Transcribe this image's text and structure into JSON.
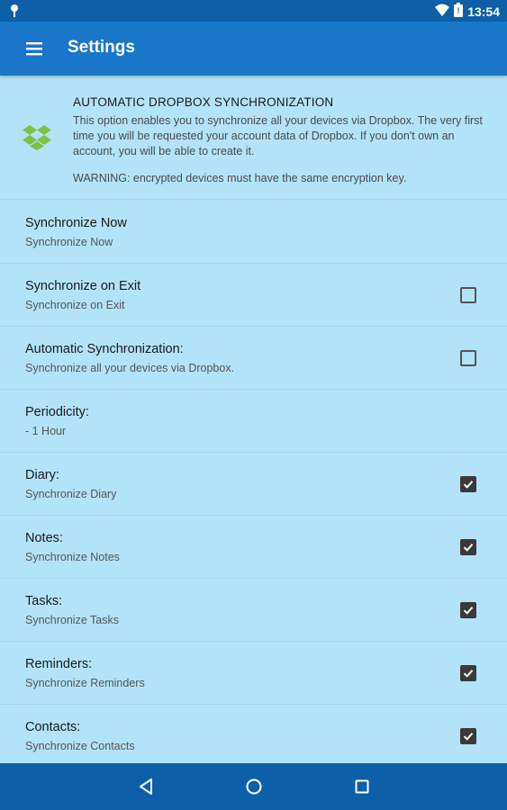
{
  "status_bar": {
    "time": "13:54",
    "icons": [
      "pin-icon",
      "wifi-icon",
      "battery-icon"
    ]
  },
  "app_bar": {
    "title": "Settings",
    "menu_icon": "hamburger-icon"
  },
  "header": {
    "title": "AUTOMATIC DROPBOX SYNCHRONIZATION",
    "description": "This option enables you to synchronize all your devices via Dropbox. The very first time you will be requested your account data of Dropbox. If you don't own an account, you will be able to create it.",
    "warning": "WARNING: encrypted devices must have the same encryption key.",
    "icon": "dropbox-icon"
  },
  "items": [
    {
      "title": "Synchronize Now",
      "summary": "Synchronize Now",
      "checkbox": null
    },
    {
      "title": "Synchronize on Exit",
      "summary": "Synchronize on Exit",
      "checkbox": false
    },
    {
      "title": "Automatic Synchronization:",
      "summary": "Synchronize all your devices via Dropbox.",
      "checkbox": false
    },
    {
      "title": "Periodicity:",
      "summary": " - 1 Hour",
      "checkbox": null
    },
    {
      "title": "Diary:",
      "summary": "Synchronize Diary",
      "checkbox": true
    },
    {
      "title": "Notes:",
      "summary": "Synchronize Notes",
      "checkbox": true
    },
    {
      "title": "Tasks:",
      "summary": "Synchronize Tasks",
      "checkbox": true
    },
    {
      "title": "Reminders:",
      "summary": "Synchronize Reminders",
      "checkbox": true
    },
    {
      "title": "Contacts:",
      "summary": "Synchronize Contacts",
      "checkbox": true
    }
  ],
  "nav_bar": {
    "buttons": [
      "back-icon",
      "home-icon",
      "recents-icon"
    ]
  },
  "colors": {
    "status_bar": "#0d60a8",
    "app_bar": "#1976c8",
    "background": "#b3e3f9",
    "dropbox": "#7cc243"
  }
}
